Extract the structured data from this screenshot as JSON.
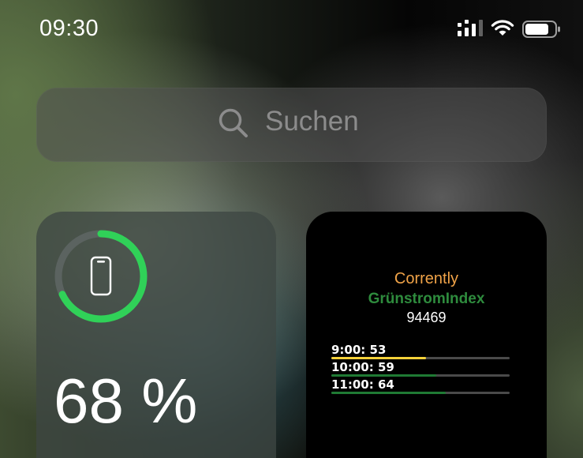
{
  "status_bar": {
    "time": "09:30",
    "signal_icon": "cellular-signal-icon",
    "wifi_icon": "wifi-icon",
    "battery_icon": "battery-icon"
  },
  "search": {
    "icon": "search-icon",
    "placeholder": "Suchen"
  },
  "battery_widget": {
    "device_icon": "iphone-icon",
    "level": 0.68,
    "percent_label": "68 %",
    "ring_color": "#30d158"
  },
  "gruenstrom_widget": {
    "title": "Corrently",
    "subtitle": "GrünstromIndex",
    "zip": "94469",
    "forecast": [
      {
        "label": "9:00: 53",
        "value": 53,
        "color": "#f5d13a"
      },
      {
        "label": "10:00: 59",
        "value": 59,
        "color": "#1f7a34"
      },
      {
        "label": "11:00: 64",
        "value": 64,
        "color": "#1f7a34"
      }
    ]
  }
}
